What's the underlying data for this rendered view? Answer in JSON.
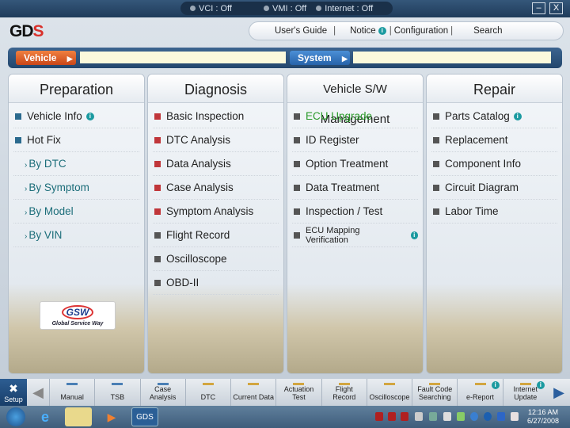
{
  "status": {
    "vci": "VCI : Off",
    "vmi": "VMI : Off",
    "internet": "Internet : Off"
  },
  "window": {
    "minimize": "–",
    "close": "X"
  },
  "logo": {
    "text": "GD",
    "accent": "S"
  },
  "topnav": [
    "User's Guide",
    "Notice",
    "Configuration",
    "Search"
  ],
  "path": {
    "vehicle": "Vehicle",
    "system": "System",
    "vehicle_value": "",
    "system_value": ""
  },
  "columns": [
    {
      "title": "Preparation",
      "icon_color": "#2a6a8e",
      "items": [
        {
          "label": "Vehicle Info",
          "info": true
        },
        {
          "label": "Hot Fix"
        },
        {
          "label": "By DTC",
          "sub": true
        },
        {
          "label": "By Symptom",
          "sub": true
        },
        {
          "label": "By Model",
          "sub": true
        },
        {
          "label": "By VIN",
          "sub": true
        }
      ]
    },
    {
      "title": "Diagnosis",
      "icon_color": "#c0363a",
      "items": [
        {
          "label": "Basic Inspection"
        },
        {
          "label": "DTC Analysis"
        },
        {
          "label": "Data Analysis"
        },
        {
          "label": "Case Analysis"
        },
        {
          "label": "Symptom Analysis"
        },
        {
          "label": "Flight Record",
          "gray": true
        },
        {
          "label": "Oscilloscope",
          "gray": true
        },
        {
          "label": "OBD-II",
          "gray": true
        }
      ]
    },
    {
      "title": "Vehicle S/W Management",
      "icon_color": "#555",
      "items": [
        {
          "label": "ECU Upgrade",
          "green": true
        },
        {
          "label": "ID Register"
        },
        {
          "label": "Option Treatment"
        },
        {
          "label": "Data Treatment"
        },
        {
          "label": "Inspection / Test"
        },
        {
          "label": "ECU Mapping Verification",
          "info": true,
          "small": true
        }
      ]
    },
    {
      "title": "Repair",
      "icon_color": "#555",
      "items": [
        {
          "label": "Parts Catalog",
          "info": true
        },
        {
          "label": "Replacement"
        },
        {
          "label": "Component Info"
        },
        {
          "label": "Circuit Diagram"
        },
        {
          "label": "Labor Time"
        }
      ]
    }
  ],
  "gsw": {
    "logo": "GSW",
    "tagline": "Global Service Way"
  },
  "toolbar": {
    "setup": "Setup",
    "items": [
      {
        "label": "Manual",
        "color": "#4a7fb5"
      },
      {
        "label": "TSB",
        "color": "#4a7fb5"
      },
      {
        "label": "Case Analysis",
        "color": "#4a7fb5"
      },
      {
        "label": "DTC",
        "color": "#d2a640"
      },
      {
        "label": "Current Data",
        "color": "#d2a640"
      },
      {
        "label": "Actuation Test",
        "color": "#d2a640"
      },
      {
        "label": "Flight Record",
        "color": "#d2a640"
      },
      {
        "label": "Oscilloscope",
        "color": "#d2a640"
      },
      {
        "label": "Fault Code Searching",
        "color": "#d2a640"
      },
      {
        "label": "e-Report",
        "color": "#d2a640",
        "info": true
      },
      {
        "label": "Internet Update",
        "color": "#d2a640",
        "info": true
      }
    ]
  },
  "taskbar": {
    "gds": "GDS",
    "time": "12:16 AM",
    "date": "6/27/2008"
  }
}
